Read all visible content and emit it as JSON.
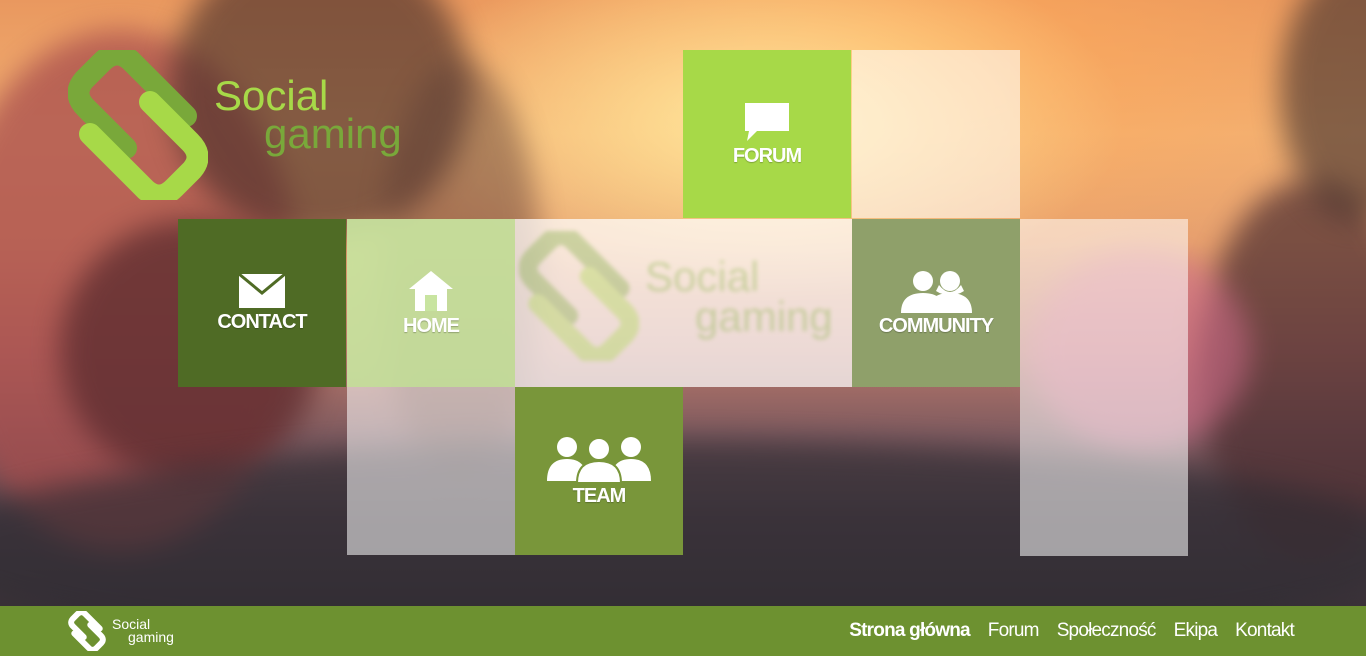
{
  "brand": {
    "line1": "Social",
    "line2": "gaming",
    "color_primary": "#a7d948",
    "color_secondary": "#79a83a"
  },
  "tiles": {
    "forum": {
      "label": "FORUM",
      "icon": "speech-bubble-icon",
      "color": "#a7d948"
    },
    "contact": {
      "label": "CONTACT",
      "icon": "envelope-icon",
      "color": "#4f6b25"
    },
    "home": {
      "label": "HOME",
      "icon": "house-icon",
      "color": "#c8e4a0"
    },
    "community": {
      "label": "COMMUNITY",
      "icon": "two-users-icon",
      "color": "#8fa06a"
    },
    "team": {
      "label": "TEAM",
      "icon": "three-users-icon",
      "color": "#79963a"
    }
  },
  "footer": {
    "brand": {
      "line1": "Social",
      "line2": "gaming"
    },
    "color": "#6d9130",
    "nav": [
      {
        "label": "Strona główna",
        "active": true
      },
      {
        "label": "Forum"
      },
      {
        "label": "Społeczność"
      },
      {
        "label": "Ekipa"
      },
      {
        "label": "Kontakt"
      }
    ]
  }
}
